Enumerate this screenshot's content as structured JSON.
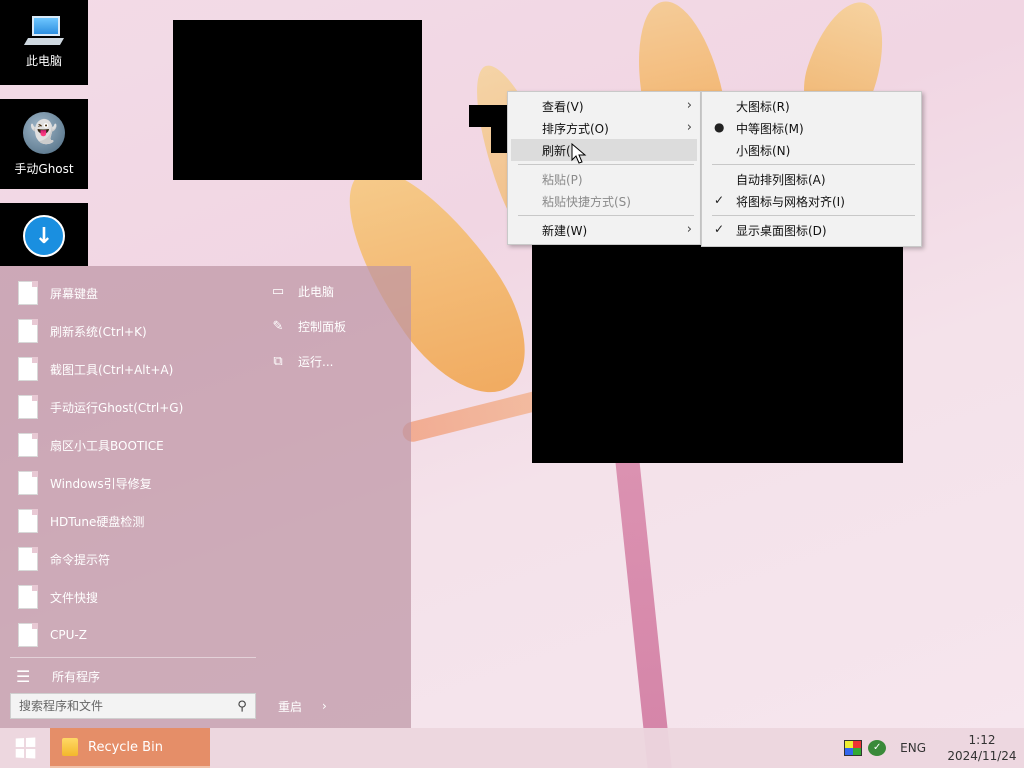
{
  "desktop": {
    "icons": [
      {
        "label": "此电脑",
        "icon": "computer-icon"
      },
      {
        "label": "手动Ghost",
        "icon": "ghost-icon"
      },
      {
        "label": "",
        "icon": "download-icon"
      }
    ]
  },
  "start_menu": {
    "left_items": [
      "屏幕键盘",
      "刷新系统(Ctrl+K)",
      "截图工具(Ctrl+Alt+A)",
      "手动运行Ghost(Ctrl+G)",
      "扇区小工具BOOTICE",
      "Windows引导修复",
      "HDTune硬盘检测",
      "命令提示符",
      "文件快搜",
      "CPU-Z"
    ],
    "all_programs": "所有程序",
    "search_placeholder": "搜索程序和文件",
    "restart": "重启",
    "right_items": [
      {
        "label": "此电脑",
        "icon": "computer-icon"
      },
      {
        "label": "控制面板",
        "icon": "wrench-icon"
      },
      {
        "label": "运行...",
        "icon": "run-icon"
      }
    ]
  },
  "context_menu": {
    "view": "查看(V)",
    "sort": "排序方式(O)",
    "refresh": "刷新(",
    "paste": "粘贴(P)",
    "paste_shortcut": "粘贴快捷方式(S)",
    "new": "新建(W)"
  },
  "view_submenu": {
    "large": "大图标(R)",
    "medium": "中等图标(M)",
    "small": "小图标(N)",
    "auto_arrange": "自动排列图标(A)",
    "align_grid": "将图标与网格对齐(I)",
    "show_desktop_icons": "显示桌面图标(D)"
  },
  "taskbar": {
    "task": "Recycle Bin",
    "lang": "ENG",
    "time": "1:12",
    "date": "2024/11/24"
  },
  "colors": {
    "taskbar_active": "#e58e68",
    "menu_bg": "#f2f2f2",
    "menu_highlight": "#dcdcdc"
  }
}
